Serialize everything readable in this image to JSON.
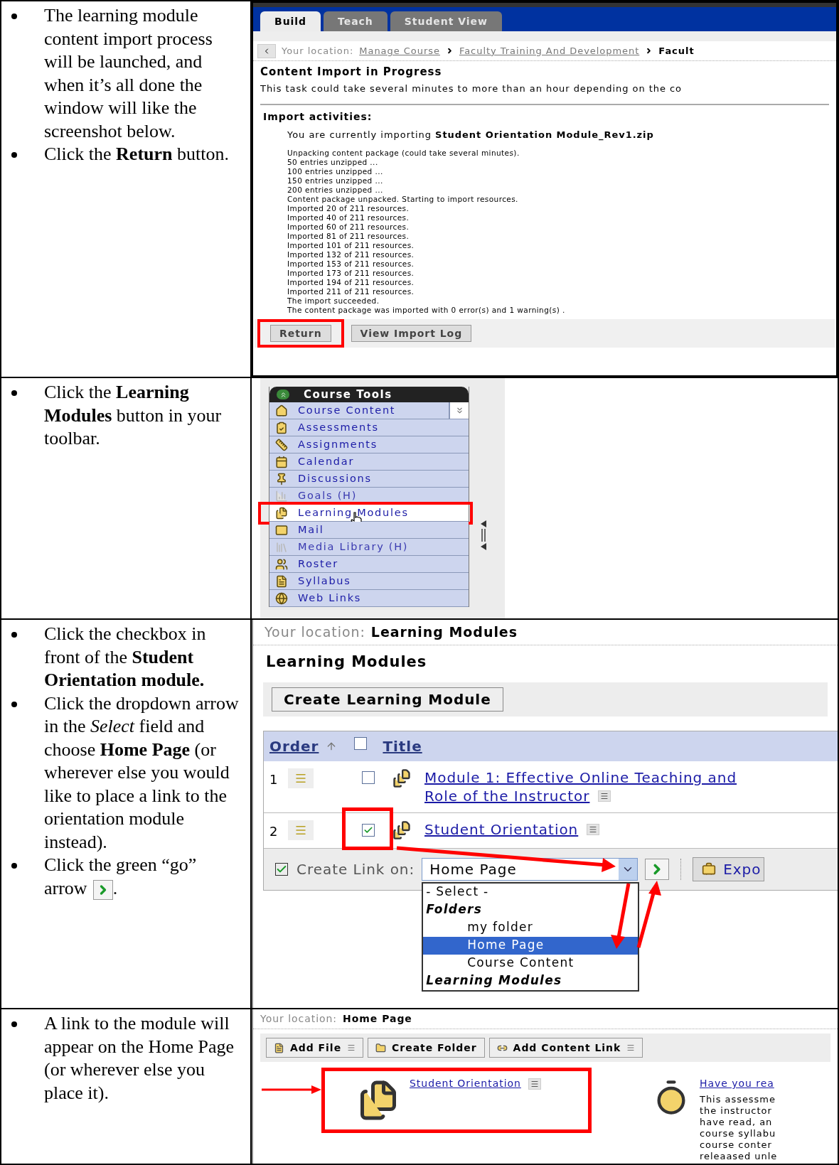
{
  "steps": [
    {
      "bullets": [
        {
          "text": "The learning module content import process will be launched, and when it’s all done the window will like the screenshot below."
        },
        {
          "text": "Click the **Return** button."
        }
      ],
      "screen": {
        "kind": "import",
        "tabs": [
          {
            "label": "Build",
            "selected": true
          },
          {
            "label": "Teach",
            "selected": false
          },
          {
            "label": "Student View",
            "selected": false
          }
        ],
        "location": {
          "label": "Your location:",
          "crumbs": [
            "Manage Course",
            "Faculty Training And Development"
          ],
          "current": "Facult"
        },
        "heading": "Content Import in Progress",
        "description": "This task could take several minutes to more than an hour depending on the co",
        "activities_label": "Import activities:",
        "importing": "You are currently importing **Student Orientation Module_Rev1.zip**",
        "log": [
          "Unpacking content package (could take several minutes).",
          "50 entries unzipped ...",
          "100 entries unzipped ...",
          "150 entries unzipped ...",
          "200 entries unzipped ...",
          "Content package unpacked. Starting to import resources.",
          "Imported 20 of 211 resources.",
          "Imported 40 of 211 resources.",
          "Imported 60 of 211 resources.",
          "Imported 81 of 211 resources.",
          "Imported 101 of 211 resources.",
          "Imported 132 of 211 resources.",
          "Imported 153 of 211 resources.",
          "Imported 173 of 211 resources.",
          "Imported 194 of 211 resources.",
          "Imported 211 of 211 resources.",
          "The import succeeded.",
          "The content package was imported with 0 error(s) and 1 warning(s) ."
        ],
        "buttons": [
          {
            "label": "Return",
            "highlighted": true
          },
          {
            "label": "View Import Log",
            "highlighted": false
          }
        ]
      }
    },
    {
      "bullets": [
        {
          "text": "Click the **Learning Modules** button in your toolbar."
        }
      ],
      "screen": {
        "kind": "toolbar",
        "title": "Course Tools",
        "items": [
          {
            "label": "Course Content",
            "hidden": false,
            "highlighted": false
          },
          {
            "label": "Assessments",
            "hidden": false,
            "highlighted": false
          },
          {
            "label": "Assignments",
            "hidden": false,
            "highlighted": false
          },
          {
            "label": "Calendar",
            "hidden": false,
            "highlighted": false
          },
          {
            "label": "Discussions",
            "hidden": false,
            "highlighted": false
          },
          {
            "label": "Goals (H)",
            "hidden": true,
            "highlighted": false
          },
          {
            "label": "Learning Modules",
            "hidden": false,
            "highlighted": true
          },
          {
            "label": "Mail",
            "hidden": false,
            "highlighted": false
          },
          {
            "label": "Media Library (H)",
            "hidden": true,
            "highlighted": false
          },
          {
            "label": "Roster",
            "hidden": false,
            "highlighted": false
          },
          {
            "label": "Syllabus",
            "hidden": false,
            "highlighted": false
          },
          {
            "label": "Web Links",
            "hidden": false,
            "highlighted": false
          }
        ]
      }
    },
    {
      "bullets": [
        {
          "text": "Click the checkbox in front of the **Student Orientation module.**"
        },
        {
          "text": "Click the dropdown arrow in the *Select* field and choose **Home Page** (or wherever else you would like to place a link to the orientation module instead)."
        },
        {
          "text": "Click the green “go” arrow",
          "end": "."
        }
      ],
      "screen": {
        "kind": "modules",
        "location": {
          "label": "Your location:",
          "current": "Learning Modules"
        },
        "heading": "Learning Modules",
        "create_button": "Create Learning Module",
        "columns": [
          "Order",
          "Title"
        ],
        "header_checked": false,
        "rows": [
          {
            "order": "1",
            "title": [
              "Module 1: Effective Online Teaching and",
              "Role of the Instructor"
            ],
            "checked": false,
            "highlighted": false
          },
          {
            "order": "2",
            "title": [
              "Student Orientation"
            ],
            "checked": true,
            "highlighted": true
          }
        ],
        "link_label": "Create Link on:",
        "select_value": "Home Page",
        "export_label": "Expo",
        "options": [
          {
            "label": "- Select -",
            "kind": "option",
            "selected": false
          },
          {
            "label": "Folders",
            "kind": "group",
            "children": [
              {
                "label": "my folder",
                "kind": "option",
                "selected": false
              },
              {
                "label": "Home Page",
                "kind": "option",
                "selected": true
              },
              {
                "label": "Course Content",
                "kind": "option",
                "selected": false
              }
            ]
          },
          {
            "label": "Learning Modules",
            "kind": "group"
          }
        ]
      }
    },
    {
      "bullets": [
        {
          "text": "A link to the module will appear on the Home Page (or wherever else you place it)."
        }
      ],
      "screen": {
        "kind": "home",
        "location": {
          "label": "Your location:",
          "current": "Home Page"
        },
        "buttons": [
          {
            "label": "Add File",
            "menu": true
          },
          {
            "label": "Create Folder",
            "menu": false
          },
          {
            "label": "Add Content Link",
            "menu": true
          }
        ],
        "items": [
          {
            "title": "Student Orientation",
            "highlighted": true
          },
          {
            "title": "Have you rea",
            "highlighted": false,
            "lines": [
              "This assessme",
              "the instructor",
              "have read, an",
              "course syllabu",
              "course conter",
              "releaased unle"
            ]
          }
        ]
      }
    }
  ]
}
